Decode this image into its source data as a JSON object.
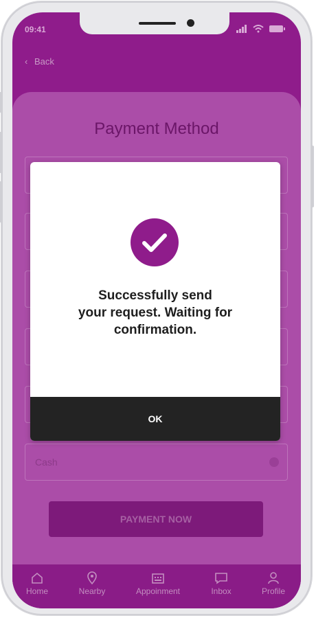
{
  "status_bar": {
    "time": "09:41"
  },
  "nav": {
    "back_label": "Back"
  },
  "payment": {
    "title": "Payment Method",
    "cash_label": "Cash",
    "pay_button": "PAYMENT NOW"
  },
  "dialog": {
    "line1": "Successfully send",
    "line2": "your request. Waiting for",
    "line3": "confirmation.",
    "ok_label": "OK"
  },
  "tabs": [
    {
      "label": "Home",
      "icon": "home-icon"
    },
    {
      "label": "Nearby",
      "icon": "location-pin-icon"
    },
    {
      "label": "Appoinment",
      "icon": "calendar-icon"
    },
    {
      "label": "Inbox",
      "icon": "chat-icon"
    },
    {
      "label": "Profile",
      "icon": "user-icon"
    }
  ],
  "colors": {
    "accent": "#8f1c8b",
    "overlay_card": "#ab4da8",
    "ok_bar": "#232323"
  }
}
